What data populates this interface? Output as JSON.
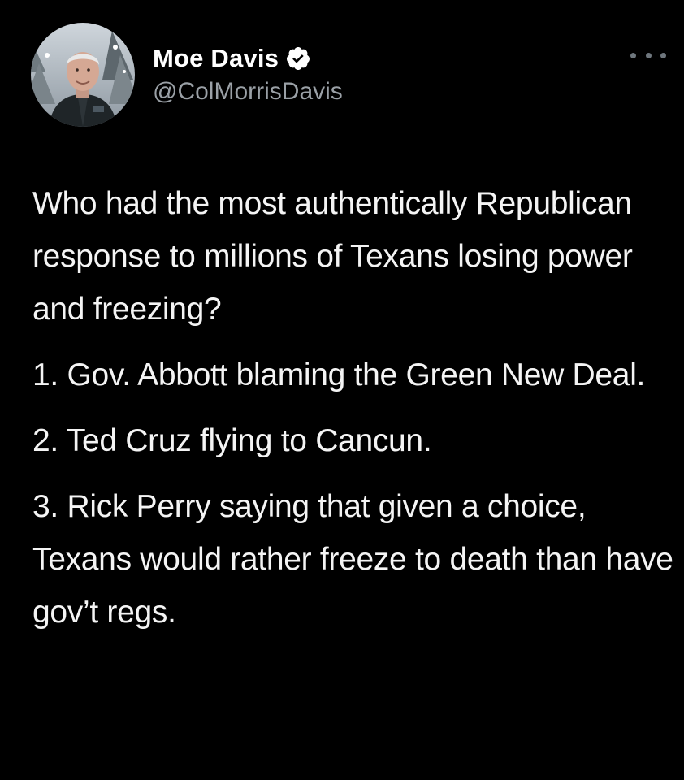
{
  "tweet": {
    "author": {
      "display_name": "Moe Davis",
      "handle": "@ColMorrisDavis",
      "verified_icon": "verified-badge-icon",
      "avatar_icon": "profile-photo"
    },
    "more_icon": "more-options-icon",
    "paragraphs": [
      "Who had the most authentically Republican response to millions of Texans losing power and freezing?",
      "1. Gov. Abbott blaming the Green New Deal.",
      "2. Ted Cruz flying to Cancun.",
      "3. Rick Perry saying that given a choice, Texans would rather freeze to death than have gov’t regs."
    ]
  },
  "colors": {
    "background": "#000000",
    "text": "#f4f4f4",
    "muted": "#9aa0a6",
    "verified": "#ffffff"
  }
}
